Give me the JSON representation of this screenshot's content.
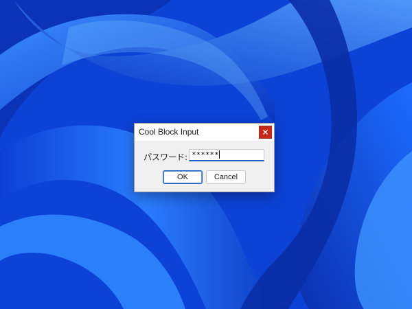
{
  "dialog": {
    "title": "Cool Block Input",
    "field_label": "パスワード:",
    "password_value": "******",
    "ok_label": "OK",
    "cancel_label": "Cancel",
    "close_icon": "close-icon"
  },
  "colors": {
    "wallpaper_base": "#0f4fe6",
    "close_button": "#c42b1c",
    "focus_accent": "#1f5fbf",
    "dialog_background": "#f0f0f0"
  }
}
